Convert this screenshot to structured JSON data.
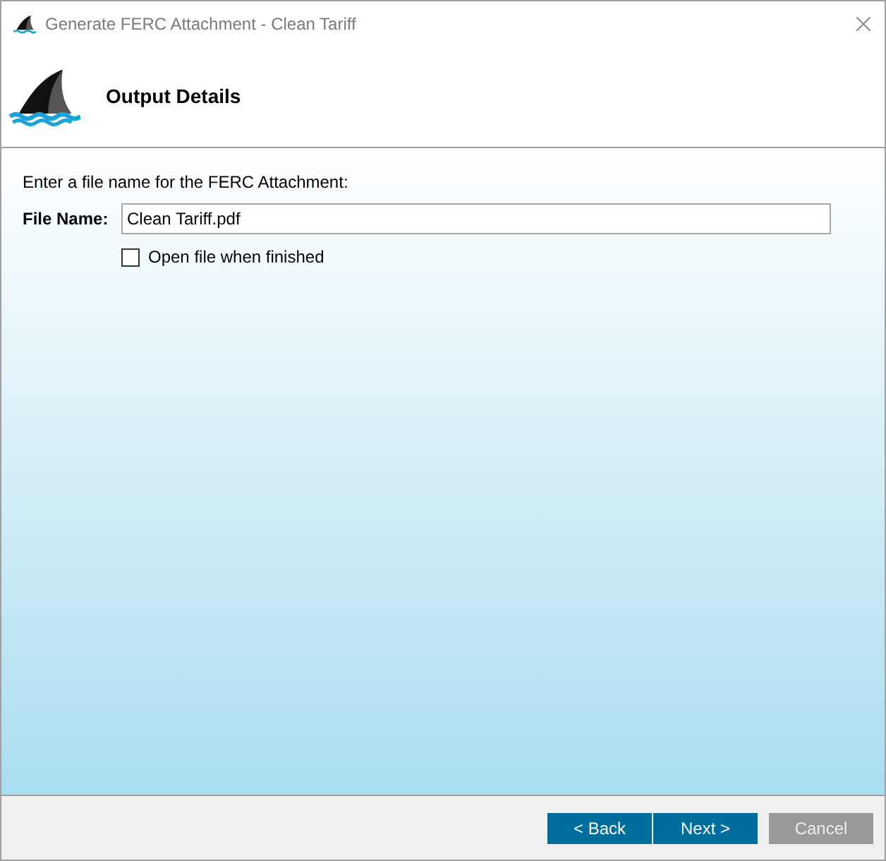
{
  "window": {
    "title": "Generate FERC Attachment - Clean Tariff"
  },
  "header": {
    "title": "Output Details"
  },
  "prompt": "Enter a file name for the FERC Attachment:",
  "file_name": {
    "label": "File Name:",
    "value": "Clean Tariff.pdf"
  },
  "open_when_finished": {
    "label": "Open file when finished",
    "checked": false
  },
  "buttons": [
    {
      "label": "< Back",
      "disabled": false
    },
    {
      "label": "Next >",
      "disabled": false
    },
    {
      "label": "Cancel",
      "disabled": true
    }
  ]
}
